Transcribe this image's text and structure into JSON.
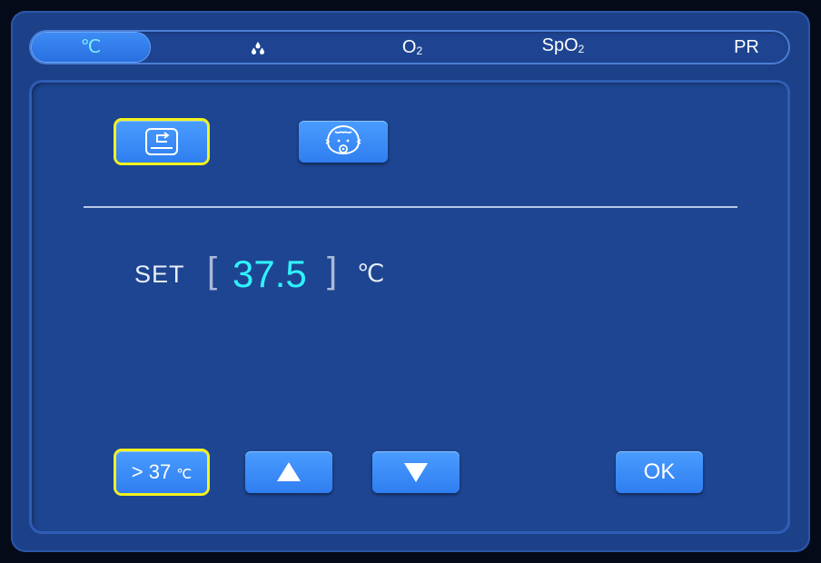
{
  "tabs": [
    {
      "label": "℃",
      "active": true
    },
    {
      "label": "",
      "icon": "water-drops-icon"
    },
    {
      "label": "O",
      "sub": "2"
    },
    {
      "label": "SpO",
      "sub": "2"
    },
    {
      "label": "PR"
    }
  ],
  "mode_buttons": [
    {
      "icon": "skin-probe-icon",
      "selected": true
    },
    {
      "icon": "baby-face-icon",
      "selected": false
    }
  ],
  "setpoint": {
    "label": "SET",
    "open_bracket": "[",
    "value": "37.5",
    "close_bracket": "]",
    "unit": "℃"
  },
  "controls": {
    "over_temp_label": "> 37",
    "over_temp_unit": "℃",
    "up_icon": "arrow-up-icon",
    "down_icon": "arrow-down-icon",
    "ok_label": "OK"
  },
  "colors": {
    "accent_value": "#2ff2ff",
    "selection": "#f2f21e",
    "button": "#3a8cf8",
    "panel": "#1e4591"
  }
}
